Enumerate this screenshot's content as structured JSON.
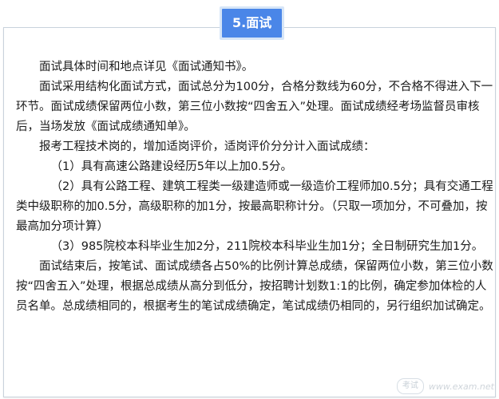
{
  "section": {
    "title": "5.面试"
  },
  "paragraphs": [
    {
      "text": "面试具体时间和地点详见《面试通知书》。",
      "style": "indent"
    },
    {
      "text": "面试采用结构化面试方式，面试总分为100分，合格分数线为60分，不合格不得进入下一环节。面试成绩保留两位小数，第三位小数按“四舍五入”处理。面试成绩经考场监督员审核后，当场发放《面试成绩通知单》。",
      "style": "indent"
    },
    {
      "text": "报考工程技术岗的，增加适岗评价，适岗评价分分计入面试成绩：",
      "style": "indent"
    },
    {
      "text": "（1）具有高速公路建设经历5年以上加0.5分。",
      "style": "indent3"
    },
    {
      "text": "（2）具有公路工程、建筑工程类一级建造师或一级造价工程师加0.5分；具有交通工程类中级职称的加0.5分，高级职称的加1分，按最高职称计分。（只取一项加分，不可叠加，按最高加分项计算）",
      "style": "indent3"
    },
    {
      "text": "（3）985院校本科毕业生加2分，211院校本科毕业生加1分；全日制研究生加1分。",
      "style": "indent3"
    },
    {
      "text": "面试结束后，按笔试、面试成绩各占50%的比例计算总成绩，保留两位小数，第三位小数按“四舍五入”处理，根据总成绩从高分到低分，按招聘计划数1:1的比例，确定参加体检的人员名单。总成绩相同的，根据考生的笔试成绩确定，笔试成绩仍相同的，另行组织加试确定。",
      "style": "indent"
    }
  ],
  "watermark": {
    "logo_text": "考试",
    "site_text": "www.exam.net",
    "logo_icon": "exam-logo-icon"
  },
  "colors": {
    "title_bg": "#4a86e8",
    "title_border": "#d6e5f7",
    "text": "#1a1a1a"
  }
}
